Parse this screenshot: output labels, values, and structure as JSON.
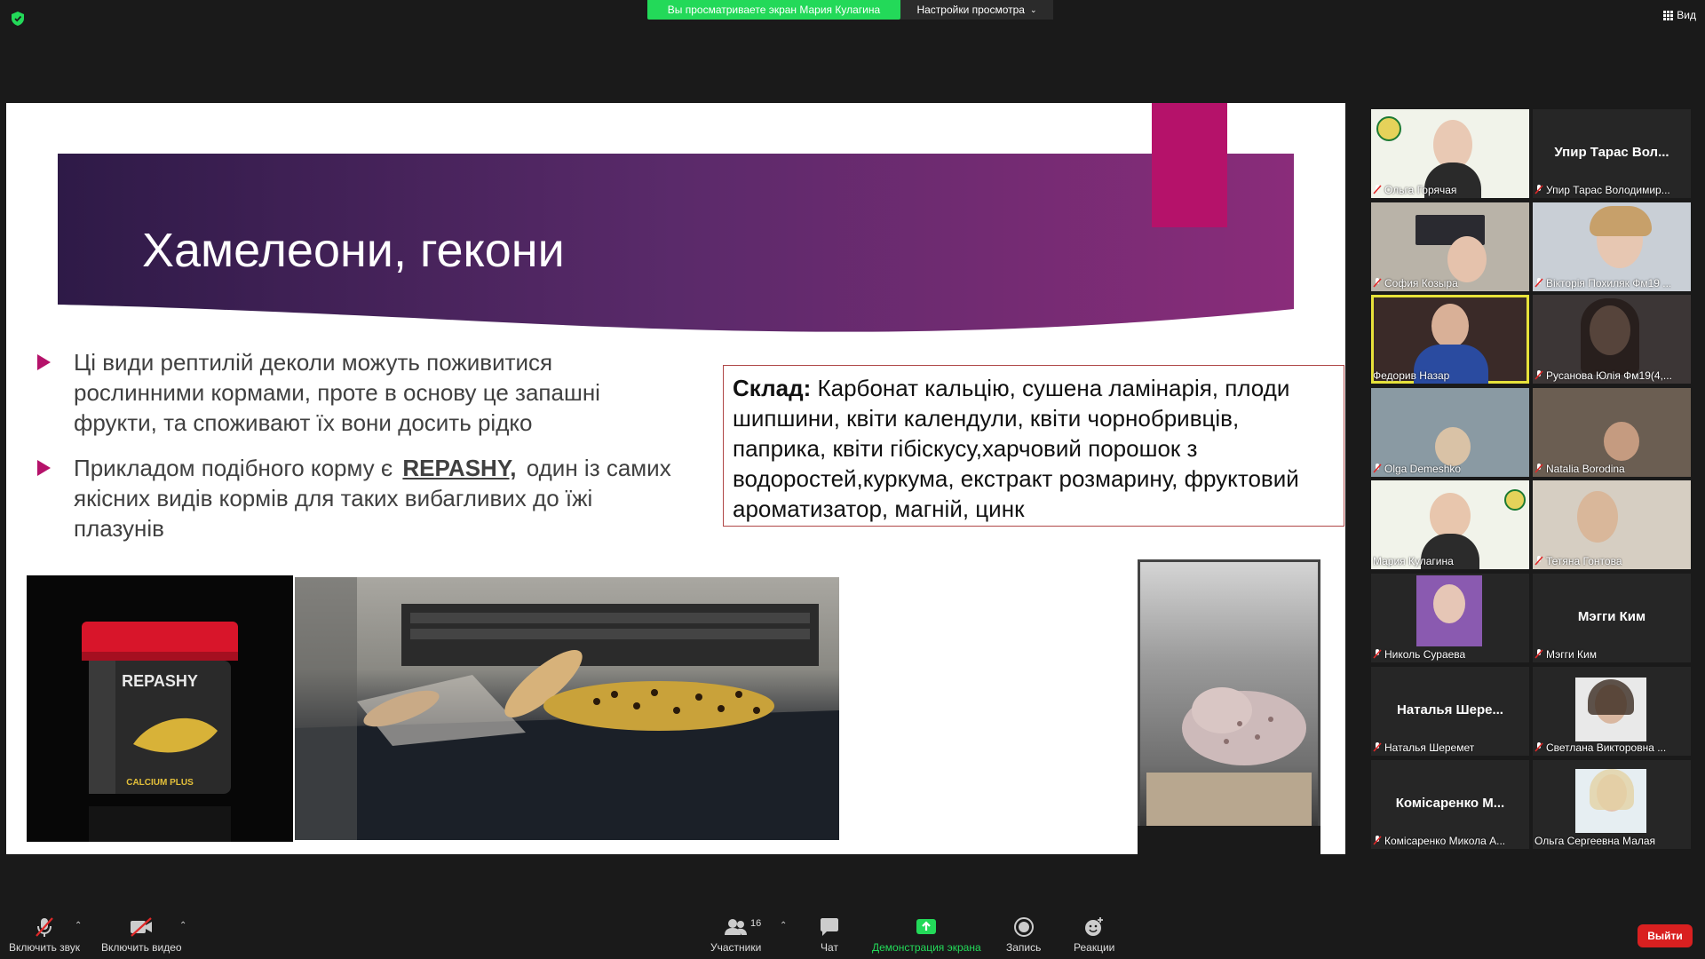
{
  "topbar": {
    "share_banner": "Вы просматриваете экран Мария Кулагина",
    "view_options": "Настройки просмотра",
    "view_button": "Вид"
  },
  "slide": {
    "title": "Хамелеони, гекони",
    "bullet1": "Ці види рептилій деколи можуть поживитися рослинними кормами, проте в основу це запашні фрукти, та споживают їх вони досить рідко",
    "bullet2_pre": "Прикладом подібного корму є",
    "bullet2_brand": "REPASHY,",
    "bullet2_post": "один із самих якісних видів кормів для таких вибагливих до їжі плазунів",
    "composition_label": "Склад:",
    "composition_text": "Карбонат кальцію, сушена ламінарія, плоди шипшини, квіти календули, квіти чорнобривців, паприка, квіти гібіскусу,харчовий порошок з водоростей,куркума, екстракт розмарину, фруктовий ароматизатор, магній, цинк",
    "jar_brand": "REPASHY",
    "jar_sub": "CALCIUM PLUS"
  },
  "participants": [
    {
      "label": "Ольга Горячая",
      "big": "",
      "video": true
    },
    {
      "label": "Упир Тарас Володимир...",
      "big": "Упир Тарас Вол...",
      "video": false
    },
    {
      "label": "София Козыра",
      "big": "",
      "video": true
    },
    {
      "label": "Вікторія Похиляк Фм19 ...",
      "big": "",
      "video": true
    },
    {
      "label": "Федорив Назар",
      "big": "",
      "video": true
    },
    {
      "label": "Русанова Юлія Фм19(4,...",
      "big": "",
      "video": true
    },
    {
      "label": "Olga Demeshko",
      "big": "",
      "video": true
    },
    {
      "label": "Natalia Borodina",
      "big": "",
      "video": true
    },
    {
      "label": "Мария Кулагина",
      "big": "",
      "video": true
    },
    {
      "label": "Тетяна Гонтова",
      "big": "",
      "video": true
    },
    {
      "label": "Николь Сураева",
      "big": "",
      "video": true
    },
    {
      "label": "Мэгги Ким",
      "big": "Мэгги Ким",
      "video": false
    },
    {
      "label": "Наталья Шеремет",
      "big": "Наталья Шере...",
      "video": false
    },
    {
      "label": "Светлана Викторовна ...",
      "big": "",
      "video": true
    },
    {
      "label": "Комісаренко Микола А...",
      "big": "Комісаренко М...",
      "video": false
    },
    {
      "label": "Ольга Сергеевна Малая",
      "big": "",
      "video": true
    }
  ],
  "toolbar": {
    "audio": "Включить звук",
    "video": "Включить видео",
    "participants": "Участники",
    "participants_count": "16",
    "chat": "Чат",
    "share": "Демонстрация экрана",
    "record": "Запись",
    "reactions": "Реакции",
    "leave": "Выйти"
  },
  "colors": {
    "share_green": "#23d959",
    "accent_pink": "#b5126a",
    "leave_red": "#d92020",
    "active_speaker": "#e7e23a"
  }
}
